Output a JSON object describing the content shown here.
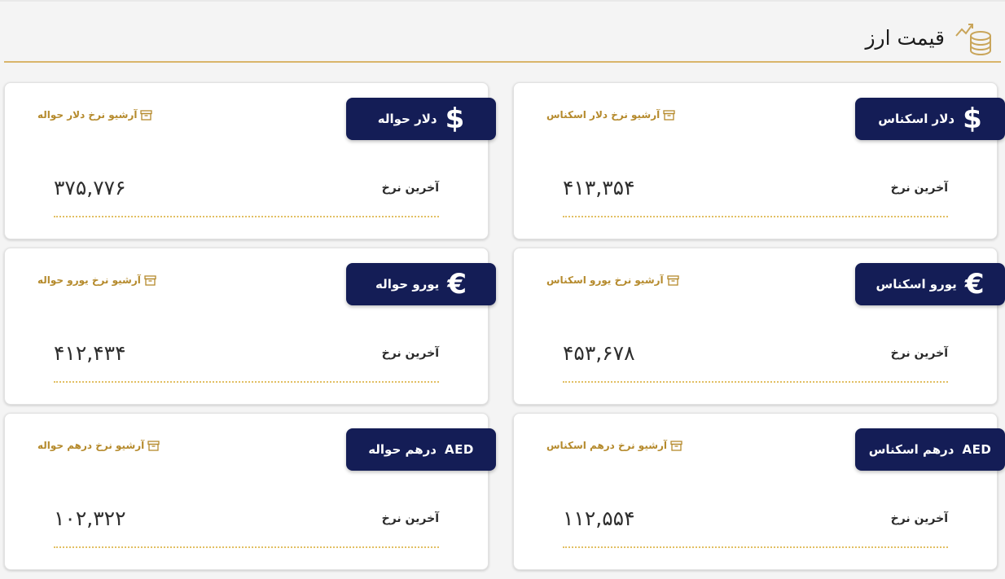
{
  "header": {
    "title": "قیمت ارز"
  },
  "colors": {
    "accent_gold": "#d9b56a",
    "badge_navy": "#141d56",
    "archive_gold": "#b58a2c"
  },
  "cards": [
    {
      "name": "dollar-cash",
      "label": "دلار اسکناس",
      "symbol": "$",
      "symbol_icon": "dollar-icon",
      "archive": "آرشیو نرخ دلار اسکناس",
      "rate_label": "آخرین نرخ",
      "value": "۴۱۳,۳۵۴"
    },
    {
      "name": "dollar-transfer",
      "label": "دلار حواله",
      "symbol": "$",
      "symbol_icon": "dollar-icon",
      "archive": "آرشیو نرخ دلار حواله",
      "rate_label": "آخرین نرخ",
      "value": "۳۷۵,۷۷۶"
    },
    {
      "name": "euro-cash",
      "label": "یورو اسکناس",
      "symbol": "€",
      "symbol_icon": "euro-icon",
      "archive": "آرشیو نرخ یورو اسکناس",
      "rate_label": "آخرین نرخ",
      "value": "۴۵۳,۶۷۸"
    },
    {
      "name": "euro-transfer",
      "label": "یورو حواله",
      "symbol": "€",
      "symbol_icon": "euro-icon",
      "archive": "آرشیو نرخ یورو حواله",
      "rate_label": "آخرین نرخ",
      "value": "۴۱۲,۴۳۴"
    },
    {
      "name": "dirham-cash",
      "label": "درهم اسکناس",
      "symbol": "AED",
      "symbol_icon": "aed-icon",
      "archive": "آرشیو نرخ درهم اسکناس",
      "rate_label": "آخرین نرخ",
      "value": "۱۱۲,۵۵۴"
    },
    {
      "name": "dirham-transfer",
      "label": "درهم حواله",
      "symbol": "AED",
      "symbol_icon": "aed-icon",
      "archive": "آرشیو نرخ درهم حواله",
      "rate_label": "آخرین نرخ",
      "value": "۱۰۲,۳۲۲"
    }
  ]
}
